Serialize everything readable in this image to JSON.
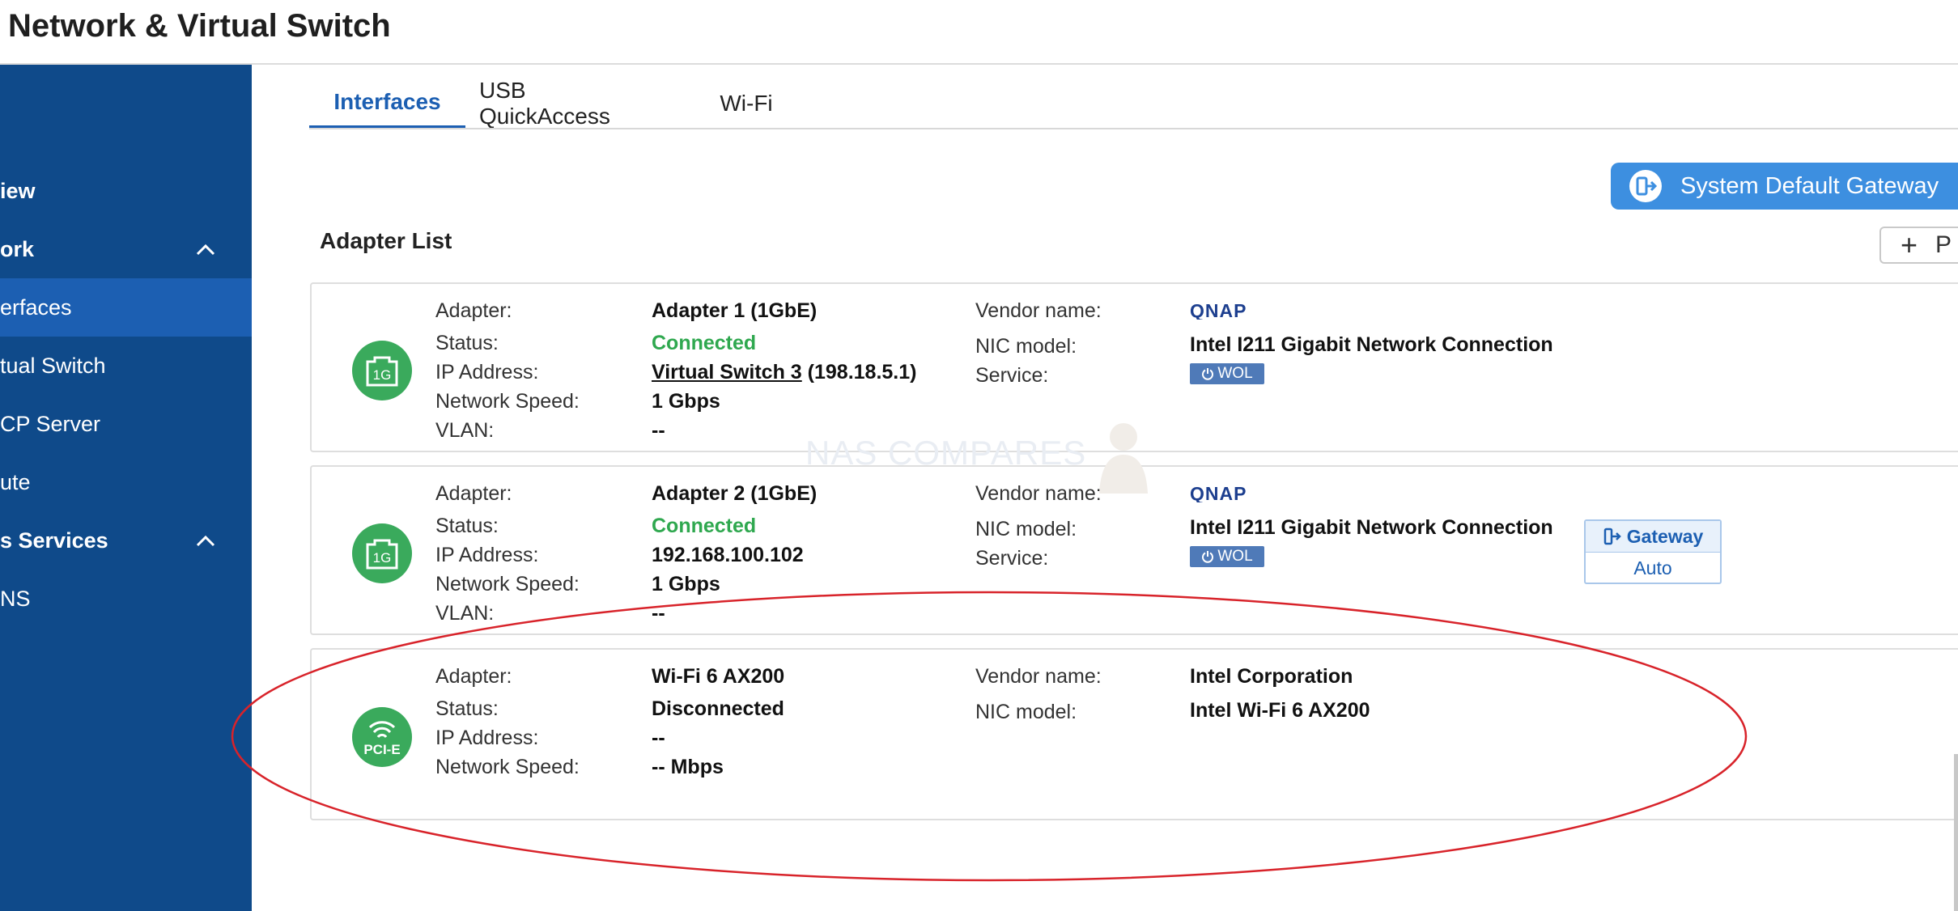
{
  "app": {
    "title": "Network & Virtual Switch"
  },
  "sidebar": {
    "items": [
      {
        "label": "iew"
      },
      {
        "label": "ork"
      },
      {
        "label": "erfaces"
      },
      {
        "label": "tual Switch"
      },
      {
        "label": "CP Server"
      },
      {
        "label": "ute"
      },
      {
        "label": "s Services"
      },
      {
        "label": "NS"
      }
    ]
  },
  "tabs": [
    {
      "label": "Interfaces",
      "active": true
    },
    {
      "label": "USB QuickAccess"
    },
    {
      "label": "Wi-Fi"
    }
  ],
  "toolbar": {
    "gateway_button": "System Default Gateway",
    "add_button_label": "P"
  },
  "section": {
    "title": "Adapter List"
  },
  "labels": {
    "adapter": "Adapter:",
    "status": "Status:",
    "ip": "IP Address:",
    "speed": "Network Speed:",
    "vlan": "VLAN:",
    "vendor": "Vendor name:",
    "nic": "NIC model:",
    "service": "Service:"
  },
  "adapters": [
    {
      "icon_text": "1G",
      "name": "Adapter 1 (1GbE)",
      "status": "Connected",
      "ip_link": "Virtual Switch 3",
      "ip_suffix": " (198.18.5.1)",
      "speed": "1 Gbps",
      "vlan": "--",
      "vendor": "QNAP",
      "nic": "Intel I211 Gigabit Network Connection",
      "service": "WOL"
    },
    {
      "icon_text": "1G",
      "name": "Adapter 2 (1GbE)",
      "status": "Connected",
      "ip": "192.168.100.102",
      "speed": "1 Gbps",
      "vlan": "--",
      "vendor": "QNAP",
      "nic": "Intel I211 Gigabit Network Connection",
      "service": "WOL",
      "gateway_label": "Gateway",
      "gateway_mode": "Auto"
    },
    {
      "icon_text": "PCI-E",
      "name": "Wi-Fi 6 AX200",
      "status": "Disconnected",
      "ip": "--",
      "speed": "-- Mbps",
      "vendor": "Intel Corporation",
      "nic": "Intel Wi-Fi 6 AX200"
    }
  ],
  "watermark": "NAS COMPARES",
  "colors": {
    "sidebar": "#0f4a8a",
    "sidebar_active": "#1c5fb2",
    "accent": "#1c5fb2",
    "button": "#3d8fe0",
    "connected": "#2fa84f",
    "adapter_icon": "#3aaa5c",
    "highlight_ellipse": "#d8232a"
  }
}
